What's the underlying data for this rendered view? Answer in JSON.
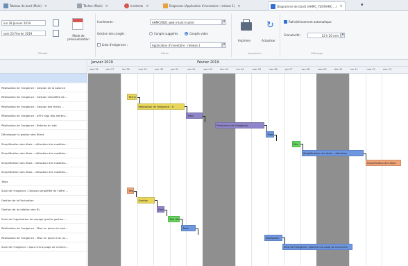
{
  "colors": {
    "accent": "#2f6fd6",
    "weekend": "#8f8f8f",
    "bar_yellow": "#e8d75a",
    "bar_purple": "#8f86c9",
    "bar_blue": "#6f97e0",
    "bar_green": "#66d45f",
    "bar_salmon": "#f0a57a",
    "selected_row": "#cfe0f7"
  },
  "tabs": [
    {
      "label": "Tableau de bord (Main)",
      "icon": "grid-icon",
      "color": "#6d8fb8",
      "active": false
    },
    {
      "label": "Tâches (Main)",
      "icon": "wrench-icon",
      "color": "#9aa3ad",
      "active": false
    },
    {
      "label": "Incidents",
      "icon": "bug-icon",
      "color": "#d9534f",
      "active": false
    },
    {
      "label": "Exigences (Application d'inventaire : release 1)",
      "icon": "pencil-icon",
      "color": "#e8a33d",
      "active": false
    },
    {
      "label": "Diagramme de Gantt (AHMC_TDCMARK_...)",
      "icon": "gantt-icon",
      "color": "#2f6fd6",
      "active": true
    }
  ],
  "ribbon": {
    "date_start": "lun 28 Janvier 2019",
    "date_end": "sam 23 Février 2019",
    "mode_label": "Mode de prévisualisation",
    "increments_label": "Incréments :",
    "increments_value": "AHMC/KDO_web (main) (suite)",
    "conges_label": "Gestion des congés :",
    "conges_opt1": "Congés suggérés",
    "conges_opt2": "Congés vides",
    "exigences_label": "Liste d'exigences :",
    "exigences_value": "Application d'inventaire : release 1",
    "print_label": "Imprimer",
    "refresh_label": "Actualiser",
    "autorefresh_label": "Rafraîchissement automatique",
    "zoom_label": "Granularité :",
    "zoom_value": "12 h 20 mm",
    "group_periode": "Période",
    "group_filtres": "Filtres",
    "group_impression": "Impression",
    "group_affichage": "Affichage"
  },
  "timeline": {
    "months": [
      "Janvier 2019",
      "Février 2019"
    ],
    "days": [
      "sam 26",
      "dim 27",
      "lun 28",
      "mar 29",
      "mer 30",
      "jeu 31",
      "ven 01",
      "sam 02",
      "dim 03",
      "lun 04",
      "mar 05",
      "mer 06",
      "jeu 07",
      "ven 08",
      "sam 09",
      "dim 10",
      "lun 11",
      "mar 12",
      "mer 13"
    ]
  },
  "tasks": [
    "",
    "Réalisation de l'exigence : Gestion de la balance",
    "Réalisation de l'exigence : Gestion simplifiée de ...",
    "Réalisation de l'exigence : Gestion des fiches ...",
    "Réalisation de l'exigence : API's hapi des alertes...",
    "Réalisation de l'exigence : Refonte du site",
    "Développer la gestion des filtres",
    "Simplification des états : utilisation des modèles...",
    "Simplification des états : utilisation des modèles...",
    "Simplification des états : utilisation des modèles...",
    "Simplification des états : utilisation des modèles...",
    "Tests",
    "Suivi de l'exigence : Gestion simplifiée de l'offre ...",
    "Gestion de la fluctuation",
    "Gestion de la création des BL",
    "Suivi de l'application de voyage (partie gestion ...",
    "Réalisation de l'exigence : Mise en place du look...",
    "Réalisation de l'exigence : Mise en place d'un ou...",
    "Suivi de l'exigence : Ajout d'une page de recherc..."
  ],
  "bars": [
    {
      "row": 2,
      "day_start": 2.4,
      "day_len": 0.6,
      "label": "Tâche",
      "color": "#e8d75a"
    },
    {
      "row": 3,
      "day_start": 3.0,
      "day_len": 2.9,
      "label": "Réalisation de l'exigence : G",
      "color": "#e8d75a"
    },
    {
      "row": 4,
      "day_start": 6.0,
      "day_len": 1.0,
      "label": "Tests",
      "color": "#8f86c9"
    },
    {
      "row": 5,
      "day_start": 7.8,
      "day_len": 3.0,
      "label": "Réalisation de l'exigence",
      "color": "#8f86c9"
    },
    {
      "row": 6,
      "day_start": 10.9,
      "day_len": 0.5,
      "label": "Tests",
      "color": "#6f97e0"
    },
    {
      "row": 7,
      "day_start": 12.5,
      "day_len": 0.5,
      "label": "Dév",
      "color": "#66d45f"
    },
    {
      "row": 8,
      "day_start": 13.1,
      "day_len": 3.8,
      "label": "Simplification des états : utilisation",
      "color": "#6f97e0"
    },
    {
      "row": 9,
      "day_start": 17.0,
      "day_len": 2.2,
      "label": "Simplification des états",
      "color": "#f0a57a"
    },
    {
      "row": 12,
      "day_start": 2.4,
      "day_len": 0.4,
      "label": "Test",
      "color": "#f0a57a"
    },
    {
      "row": 13,
      "day_start": 3.0,
      "day_len": 1.1,
      "label": "Gestion",
      "color": "#e8d75a"
    },
    {
      "row": 14,
      "day_start": 4.2,
      "day_len": 0.5,
      "label": "Gest",
      "color": "#8f86c9"
    },
    {
      "row": 15,
      "day_start": 4.9,
      "day_len": 0.7,
      "label": "Test dévt",
      "color": "#66d45f"
    },
    {
      "row": 16,
      "day_start": 5.7,
      "day_len": 0.9,
      "label": "Tests",
      "color": "#6f97e0"
    },
    {
      "row": 17,
      "day_start": 10.8,
      "day_len": 1.1,
      "label": "Réalisation",
      "color": "#6f97e0"
    },
    {
      "row": 18,
      "day_start": 11.9,
      "day_len": 4.3,
      "label": "Suivi de l'exigence : ajout d'une page de recherche",
      "color": "#6f97e0"
    }
  ]
}
